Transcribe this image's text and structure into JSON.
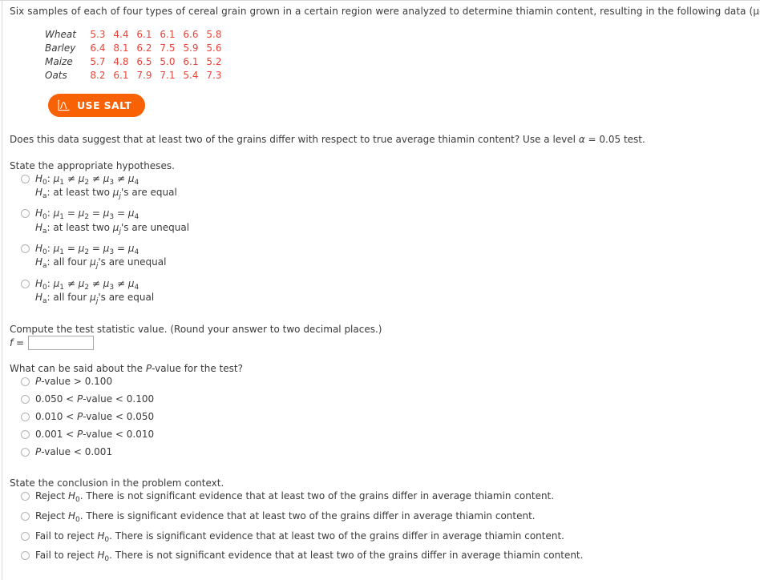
{
  "intro": {
    "text": "Six samples of each of four types of cereal grain grown in a certain region were analyzed to determine thiamin content, resulting in the following data (μg/g)."
  },
  "data_table": {
    "rows": [
      {
        "grain": "Wheat",
        "values": [
          "5.3",
          "4.4",
          "6.1",
          "6.1",
          "6.6",
          "5.8"
        ]
      },
      {
        "grain": "Barley",
        "values": [
          "6.4",
          "8.1",
          "6.2",
          "7.5",
          "5.9",
          "5.6"
        ]
      },
      {
        "grain": "Maize",
        "values": [
          "5.7",
          "4.8",
          "6.5",
          "5.0",
          "6.1",
          "5.2"
        ]
      },
      {
        "grain": "Oats",
        "values": [
          "8.2",
          "6.1",
          "7.9",
          "7.1",
          "5.4",
          "7.3"
        ]
      }
    ],
    "value_color": "#e8443a",
    "label_color": "#3a3a3a"
  },
  "salt_button": {
    "label": "USE SALT",
    "icon": "normal-distribution-icon",
    "background_color": "#f86104",
    "text_color": "#ffffff"
  },
  "question": {
    "prompt_prefix": "Does this data suggest that at least two of the grains differ with respect to true average thiamin content? Use a level ",
    "alpha_symbol": "α",
    "prompt_suffix": " = 0.05 test."
  },
  "hypotheses_section": {
    "heading": "State the appropriate hypotheses.",
    "options": [
      {
        "null": "H₀: μ₁ ≠ μ₂ ≠ μ₃ ≠ μ₄",
        "alt": "Hₐ: at least two μⱼ's are equal"
      },
      {
        "null": "H₀: μ₁ = μ₂ = μ₃ = μ₄",
        "alt": "Hₐ: at least two μⱼ's are unequal"
      },
      {
        "null": "H₀: μ₁ = μ₂ = μ₃ = μ₄",
        "alt": "Hₐ: all four μⱼ's are unequal"
      },
      {
        "null": "H₀: μ₁ ≠ μ₂ ≠ μ₃ ≠ μ₄",
        "alt": "Hₐ: all four μⱼ's are equal"
      }
    ]
  },
  "test_statistic_section": {
    "heading": "Compute the test statistic value. (Round your answer to two decimal places.)",
    "field_label": "f =",
    "field_value": "",
    "field_placeholder": ""
  },
  "pvalue_section": {
    "heading": "What can be said about the P-value for the test?",
    "options": [
      "P-value > 0.100",
      "0.050 < P-value < 0.100",
      "0.010 < P-value < 0.050",
      "0.001 < P-value < 0.010",
      "P-value < 0.001"
    ]
  },
  "conclusion_section": {
    "heading": "State the conclusion in the problem context.",
    "options": [
      "Reject H₀. There is not significant evidence that at least two of the grains differ in average thiamin content.",
      "Reject H₀. There is significant evidence that at least two of the grains differ in average thiamin content.",
      "Fail to reject H₀. There is significant evidence that at least two of the grains differ in average thiamin content.",
      "Fail to reject H₀. There is not significant evidence that at least two of the grains differ in average thiamin content."
    ]
  }
}
